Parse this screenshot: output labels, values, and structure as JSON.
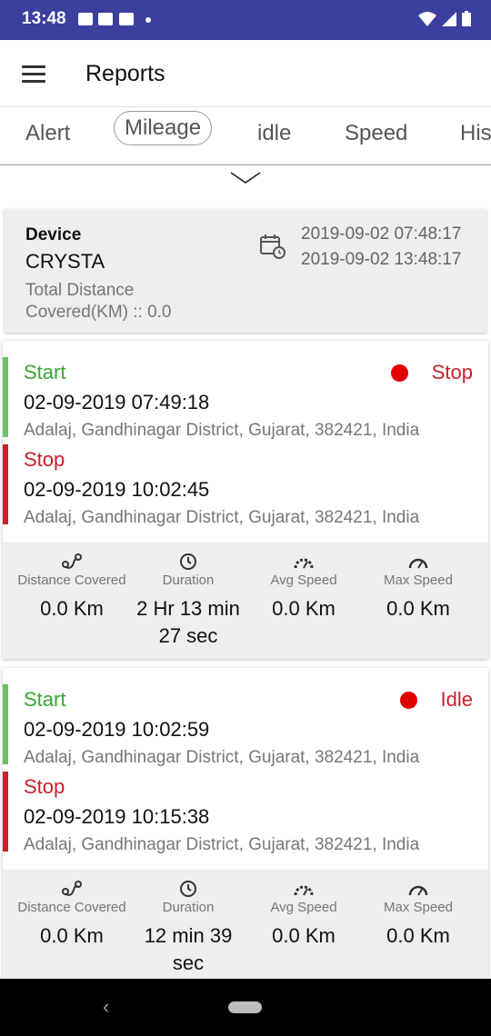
{
  "statusbar": {
    "time": "13:48"
  },
  "appbar": {
    "title": "Reports"
  },
  "tabs": [
    {
      "label": "Alert"
    },
    {
      "label": "Mileage"
    },
    {
      "label": "idle"
    },
    {
      "label": "Speed"
    },
    {
      "label": "His"
    }
  ],
  "summary": {
    "device_label": "Device",
    "device_name": "CRYSTA",
    "total_distance": "Total Distance Covered(KM) :: 0.0",
    "from_date": "2019-09-02 07:48:17",
    "to_date": "2019-09-02 13:48:17"
  },
  "trips": [
    {
      "status": "Stop",
      "start": {
        "label": "Start",
        "datetime": "02-09-2019 07:49:18",
        "address": "Adalaj, Gandhinagar District, Gujarat, 382421, India"
      },
      "stop": {
        "label": "Stop",
        "datetime": "02-09-2019 10:02:45",
        "address": "Adalaj, Gandhinagar District, Gujarat, 382421, India"
      },
      "stats": {
        "distance_label": "Distance Covered",
        "distance": "0.0 Km",
        "duration_label": "Duration",
        "duration": "2 Hr 13 min 27 sec",
        "avg_label": "Avg Speed",
        "avg": "0.0 Km",
        "max_label": "Max Speed",
        "max": "0.0 Km"
      }
    },
    {
      "status": "Idle",
      "start": {
        "label": "Start",
        "datetime": "02-09-2019 10:02:59",
        "address": "Adalaj, Gandhinagar District, Gujarat, 382421, India"
      },
      "stop": {
        "label": "Stop",
        "datetime": "02-09-2019 10:15:38",
        "address": "Adalaj, Gandhinagar District, Gujarat, 382421, India"
      },
      "stats": {
        "distance_label": "Distance Covered",
        "distance": "0.0 Km",
        "duration_label": "Duration",
        "duration": "12 min 39 sec",
        "avg_label": "Avg Speed",
        "avg": "0.0 Km",
        "max_label": "Max Speed",
        "max": "0.0 Km"
      }
    }
  ],
  "colors": {
    "statusbar": "#3b3f9e",
    "start": "#36a82c",
    "stop": "#cc1f2b",
    "status_dot": "#e00000"
  },
  "icons": [
    "menu-icon",
    "calendar-clock-icon",
    "route-icon",
    "clock-icon",
    "speedometer-icon",
    "chevron-down-icon",
    "back-icon"
  ]
}
